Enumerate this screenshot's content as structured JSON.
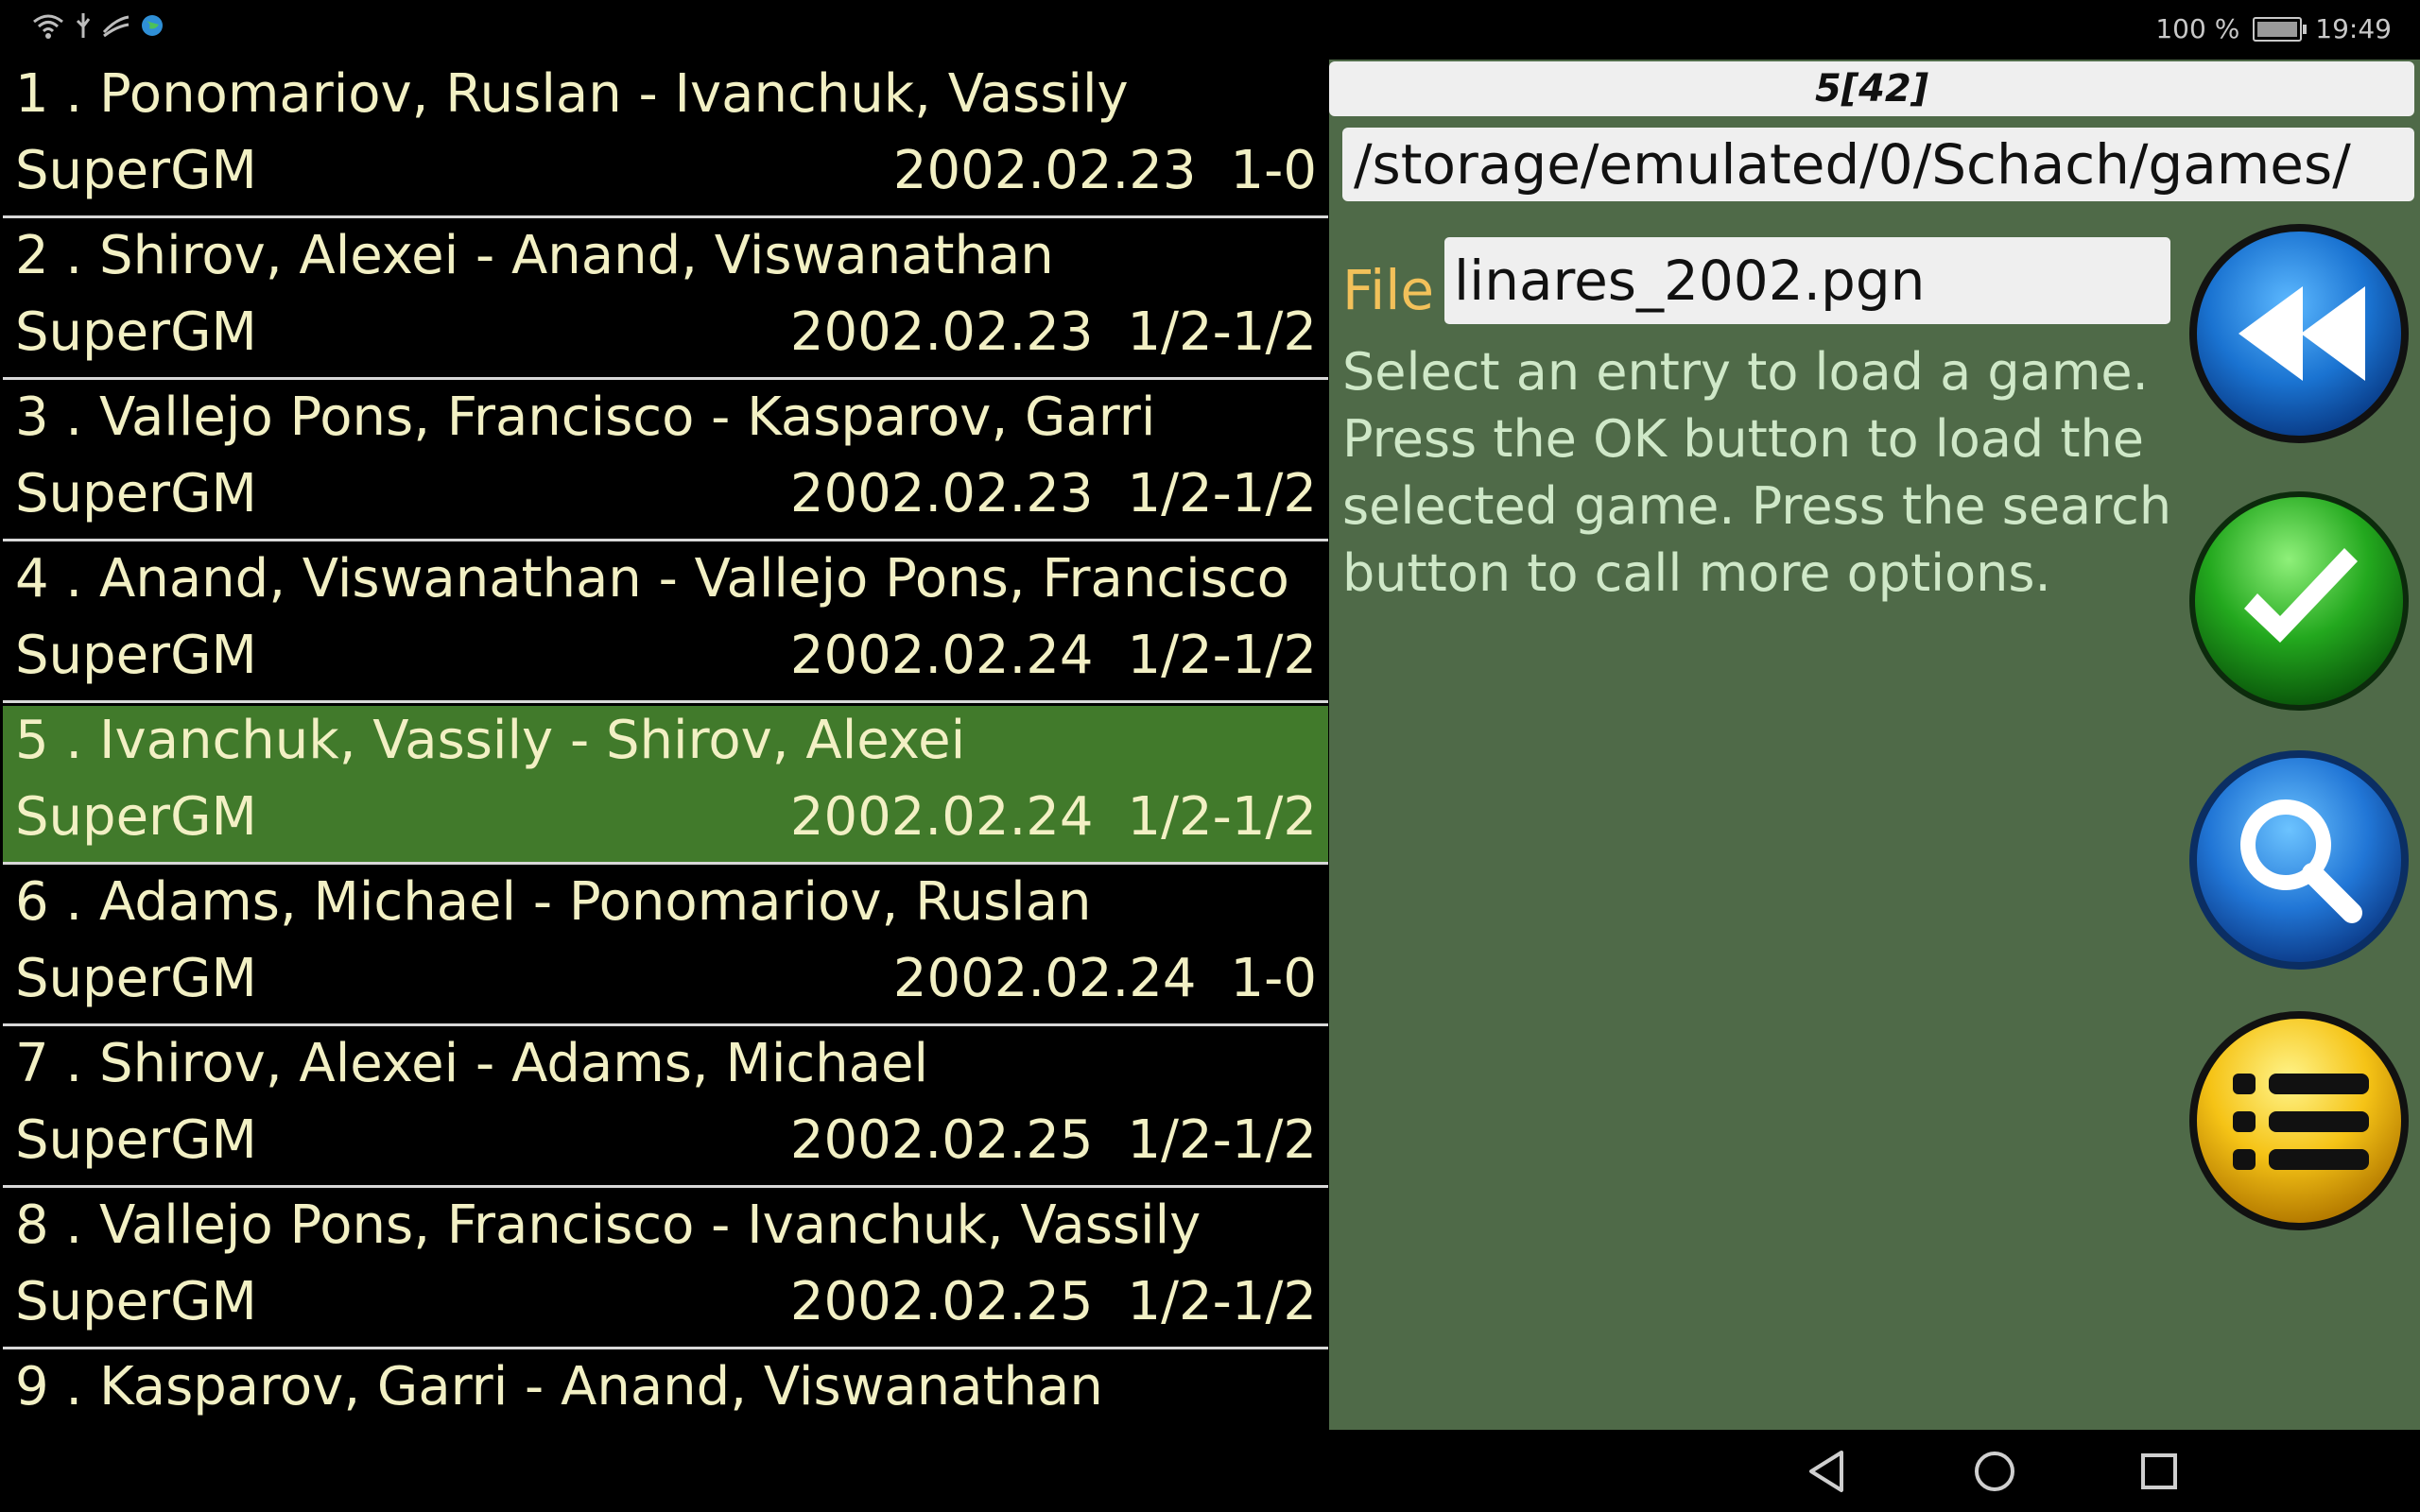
{
  "status": {
    "battery_text": "100 %",
    "time": "19:49"
  },
  "games": [
    {
      "title": "1 . Ponomariov, Ruslan  - Ivanchuk, Vassily",
      "event": "SuperGM",
      "date": "2002.02.23",
      "result": "1-0",
      "selected": false
    },
    {
      "title": "2 . Shirov, Alexei  - Anand, Viswanathan",
      "event": "SuperGM",
      "date": "2002.02.23",
      "result": "1/2-1/2",
      "selected": false
    },
    {
      "title": "3 . Vallejo Pons, Francisco  - Kasparov, Garri",
      "event": "SuperGM",
      "date": "2002.02.23",
      "result": "1/2-1/2",
      "selected": false
    },
    {
      "title": "4 . Anand, Viswanathan  - Vallejo Pons, Francisco",
      "event": "SuperGM",
      "date": "2002.02.24",
      "result": "1/2-1/2",
      "selected": false
    },
    {
      "title": "5 . Ivanchuk, Vassily  - Shirov, Alexei",
      "event": "SuperGM",
      "date": "2002.02.24",
      "result": "1/2-1/2",
      "selected": true
    },
    {
      "title": "6 . Adams, Michael  - Ponomariov, Ruslan",
      "event": "SuperGM",
      "date": "2002.02.24",
      "result": "1-0",
      "selected": false
    },
    {
      "title": "7 . Shirov, Alexei  - Adams, Michael",
      "event": "SuperGM",
      "date": "2002.02.25",
      "result": "1/2-1/2",
      "selected": false
    },
    {
      "title": "8 . Vallejo Pons, Francisco  - Ivanchuk, Vassily",
      "event": "SuperGM",
      "date": "2002.02.25",
      "result": "1/2-1/2",
      "selected": false
    },
    {
      "title": "9 . Kasparov, Garri  - Anand, Viswanathan",
      "event": "",
      "date": "",
      "result": "",
      "selected": false
    }
  ],
  "panel": {
    "counter": "5[42]",
    "path": "/storage/emulated/0/Schach/games/",
    "file_label": "File",
    "file_name": "linares_2002.pgn",
    "help_text": "Select an entry to load a game. Press the OK button to load the selected game. Press the search button to call more options."
  },
  "icons": {
    "back": "rewind-icon",
    "ok": "checkmark-icon",
    "search": "magnifier-icon",
    "menu": "list-icon"
  },
  "colors": {
    "list_bg": "#000000",
    "list_text": "#f2f0c4",
    "selected_row": "#417a2b",
    "panel_bg": "#4f6a48",
    "file_label": "#f2c15a",
    "help_text": "#cfe8c8"
  }
}
